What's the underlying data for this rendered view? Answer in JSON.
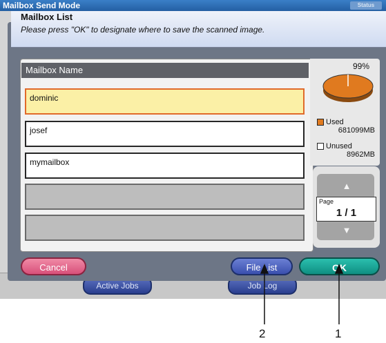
{
  "window": {
    "title": "Mailbox Send Mode",
    "status_label": "Status"
  },
  "background_buttons": [
    "Active Jobs",
    "Job Log"
  ],
  "dialog": {
    "title": "Mailbox List",
    "instruction": "Please press \"OK\" to designate where to save the scanned image.",
    "column_header": "Mailbox Name",
    "mailboxes": [
      {
        "name": "dominic",
        "selected": true
      },
      {
        "name": "josef",
        "selected": false
      },
      {
        "name": "mymailbox",
        "selected": false
      },
      {
        "name": "",
        "selected": false
      },
      {
        "name": "",
        "selected": false
      }
    ]
  },
  "storage": {
    "percent_label": "99%",
    "used_fraction": 0.99,
    "used_label": "Used",
    "used_value": "681099MB",
    "unused_label": "Unused",
    "unused_value": "8962MB",
    "colors": {
      "used": "#e07a1f",
      "unused": "#ffffff"
    }
  },
  "pager": {
    "label": "Page",
    "value": "1 / 1",
    "up_icon": "up-arrow-icon",
    "down_icon": "down-arrow-icon"
  },
  "buttons": {
    "cancel": "Cancel",
    "file_list": "File List",
    "ok": "OK"
  },
  "callouts": [
    "2",
    "1"
  ]
}
